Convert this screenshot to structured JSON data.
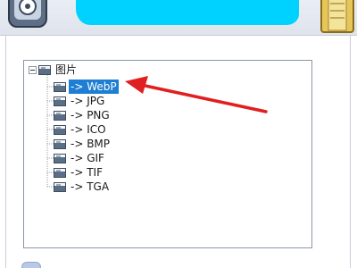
{
  "tree": {
    "root": {
      "label": "图片",
      "expanded": true
    },
    "items": [
      {
        "label": "-> WebP",
        "selected": true
      },
      {
        "label": "-> JPG",
        "selected": false
      },
      {
        "label": "-> PNG",
        "selected": false
      },
      {
        "label": "-> ICO",
        "selected": false
      },
      {
        "label": "-> BMP",
        "selected": false
      },
      {
        "label": "-> GIF",
        "selected": false
      },
      {
        "label": "-> TIF",
        "selected": false
      },
      {
        "label": "-> TGA",
        "selected": false
      }
    ]
  },
  "colors": {
    "selection": "#1e7ed3",
    "annotation_arrow": "#e02020",
    "redaction": "#00d2ff"
  }
}
